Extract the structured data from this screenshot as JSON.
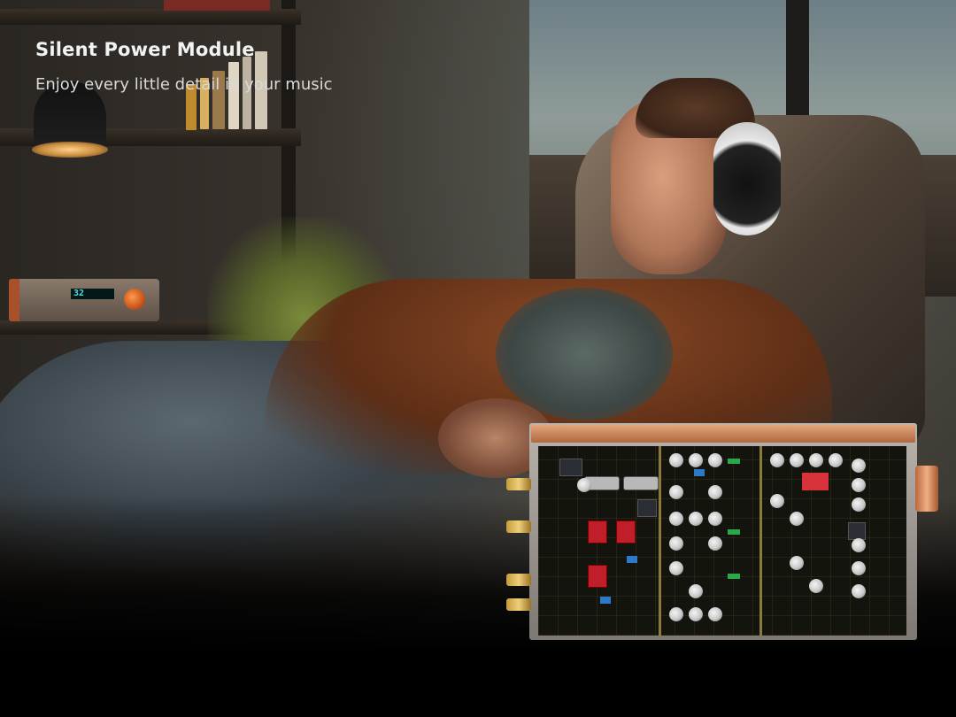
{
  "hero": {
    "headline": "Silent Power Module",
    "subheadline": "Enjoy every little detail in your music"
  },
  "product_display": {
    "readout": "32"
  },
  "colors": {
    "background": "#000000",
    "headline": "#f2f2f2",
    "subheadline": "#d9d9d9",
    "accent_copper": "#c0693c",
    "display_cyan": "#4fe0e6"
  }
}
